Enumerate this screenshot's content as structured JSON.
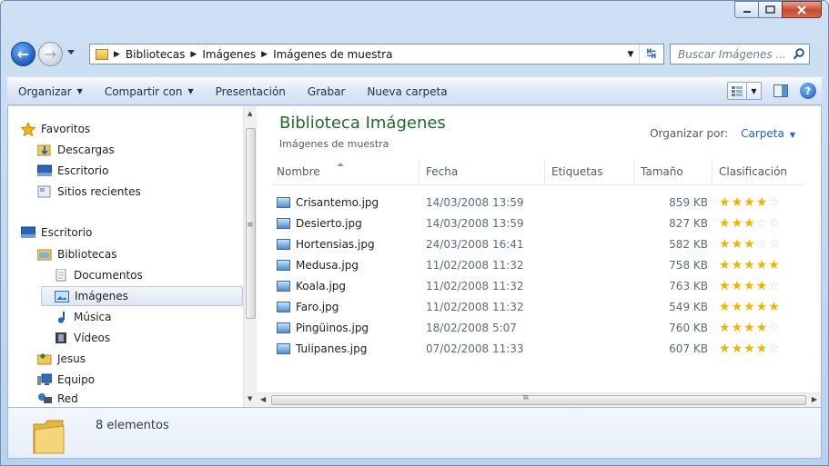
{
  "window": {
    "caption_buttons": [
      "minimize",
      "maximize",
      "close"
    ]
  },
  "address": {
    "breadcrumbs": [
      "Bibliotecas",
      "Imágenes",
      "Imágenes de muestra"
    ],
    "search_placeholder": "Buscar Imágenes ..."
  },
  "toolbar": {
    "organize": "Organizar",
    "share": "Compartir con",
    "presentation": "Presentación",
    "burn": "Grabar",
    "new_folder": "Nueva carpeta"
  },
  "nav": {
    "favorites": "Favoritos",
    "downloads": "Descargas",
    "desktop_fav": "Escritorio",
    "recent": "Sitios recientes",
    "desktop": "Escritorio",
    "libraries": "Bibliotecas",
    "documents": "Documentos",
    "images": "Imágenes",
    "music": "Música",
    "videos": "Vídeos",
    "user": "Jesus",
    "computer": "Equipo",
    "network": "Red"
  },
  "library": {
    "title": "Biblioteca Imágenes",
    "subtitle": "Imágenes de muestra",
    "arrange_label": "Organizar por:",
    "arrange_value": "Carpeta"
  },
  "columns": {
    "name": "Nombre",
    "date": "Fecha",
    "tags": "Etiquetas",
    "size": "Tamaño",
    "rating": "Clasificación"
  },
  "files": [
    {
      "name": "Crisantemo.jpg",
      "date": "14/03/2008 13:59",
      "size": "859 KB",
      "rating": 4
    },
    {
      "name": "Desierto.jpg",
      "date": "14/03/2008 13:59",
      "size": "827 KB",
      "rating": 3
    },
    {
      "name": "Hortensias.jpg",
      "date": "24/03/2008 16:41",
      "size": "582 KB",
      "rating": 3
    },
    {
      "name": "Medusa.jpg",
      "date": "11/02/2008 11:32",
      "size": "758 KB",
      "rating": 5
    },
    {
      "name": "Koala.jpg",
      "date": "11/02/2008 11:32",
      "size": "763 KB",
      "rating": 4
    },
    {
      "name": "Faro.jpg",
      "date": "11/02/2008 11:32",
      "size": "549 KB",
      "rating": 5
    },
    {
      "name": "Pingüinos.jpg",
      "date": "18/02/2008 5:07",
      "size": "760 KB",
      "rating": 4
    },
    {
      "name": "Tulipanes.jpg",
      "date": "07/02/2008 11:33",
      "size": "607 KB",
      "rating": 4
    }
  ],
  "status": {
    "count": "8 elementos"
  },
  "colors": {
    "accent": "#1f5fbf",
    "title_green": "#1e6b2e",
    "star": "#f0b400"
  }
}
